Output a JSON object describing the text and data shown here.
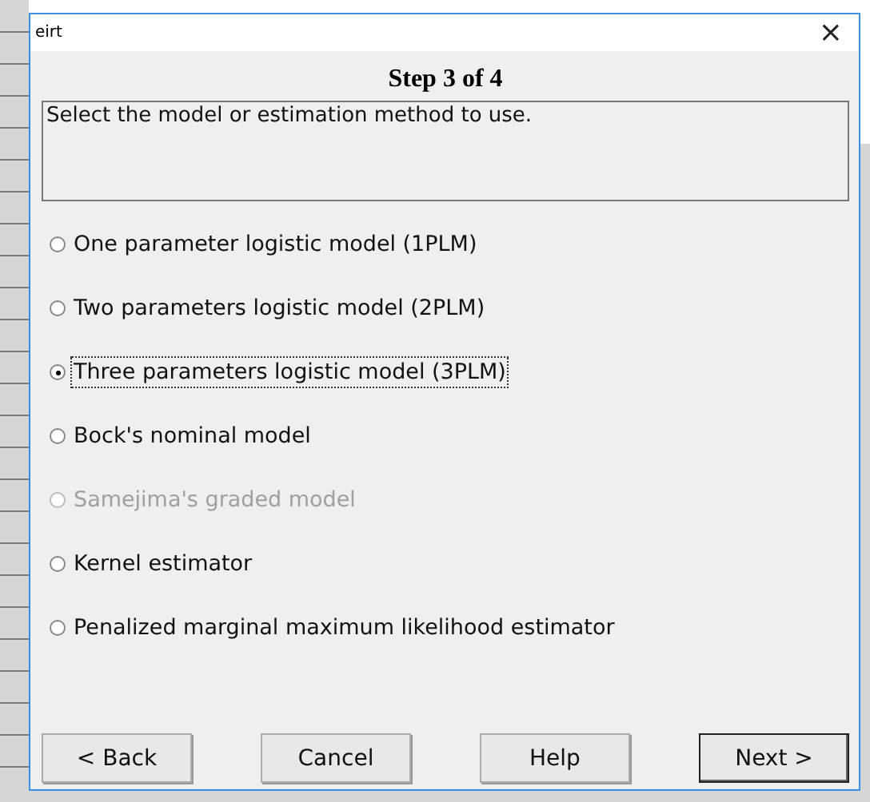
{
  "window": {
    "title": "eirt",
    "close": "×"
  },
  "heading": "Step 3 of 4",
  "description": "Select the model or estimation method to use.",
  "options": [
    {
      "label": "One parameter logistic model (1PLM)",
      "selected": false,
      "disabled": false,
      "focused": false
    },
    {
      "label": "Two parameters logistic model (2PLM)",
      "selected": false,
      "disabled": false,
      "focused": false
    },
    {
      "label": "Three parameters logistic model (3PLM)",
      "selected": true,
      "disabled": false,
      "focused": true
    },
    {
      "label": "Bock's nominal model",
      "selected": false,
      "disabled": false,
      "focused": false
    },
    {
      "label": "Samejima's graded model",
      "selected": false,
      "disabled": true,
      "focused": false
    },
    {
      "label": "Kernel estimator",
      "selected": false,
      "disabled": false,
      "focused": false
    },
    {
      "label": "Penalized marginal maximum likelihood estimator",
      "selected": false,
      "disabled": false,
      "focused": false
    }
  ],
  "buttons": [
    {
      "label": "< Back",
      "default": false
    },
    {
      "label": "Cancel",
      "default": false
    },
    {
      "label": "Help",
      "default": false
    },
    {
      "label": "Next >",
      "default": true
    }
  ]
}
